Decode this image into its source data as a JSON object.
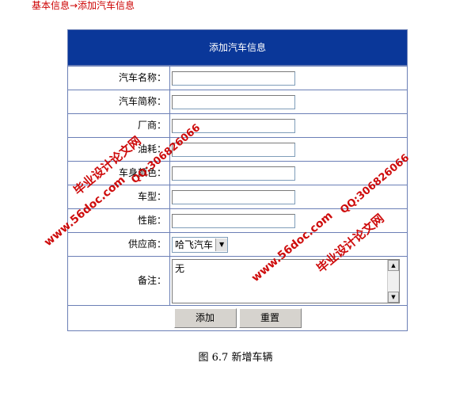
{
  "breadcrumb": "基本信息→添加汽车信息",
  "form": {
    "title": "添加汽车信息",
    "fields": [
      {
        "label": "汽车名称：",
        "value": ""
      },
      {
        "label": "汽车简称：",
        "value": ""
      },
      {
        "label": "厂商：",
        "value": ""
      },
      {
        "label": "油耗：",
        "value": ""
      },
      {
        "label": "车身颜色：",
        "value": ""
      },
      {
        "label": "车型：",
        "value": ""
      },
      {
        "label": "性能：",
        "value": ""
      }
    ],
    "supplier": {
      "label": "供应商：",
      "selected": "哈飞汽车"
    },
    "remarks": {
      "label": "备注：",
      "value": "无"
    },
    "buttons": {
      "add": "添加",
      "reset": "重置"
    }
  },
  "caption": "图 6.7  新增车辆",
  "watermarks": [
    "毕业设计论文网",
    "www.56doc.com",
    "QQ:306826066",
    "毕业设计论文网",
    "www.56doc.com",
    "QQ:306826066"
  ],
  "colors": {
    "header_bg": "#0a3799",
    "border": "#6b7fb6",
    "watermark": "#cc0000",
    "breadcrumb": "#cc0000"
  }
}
